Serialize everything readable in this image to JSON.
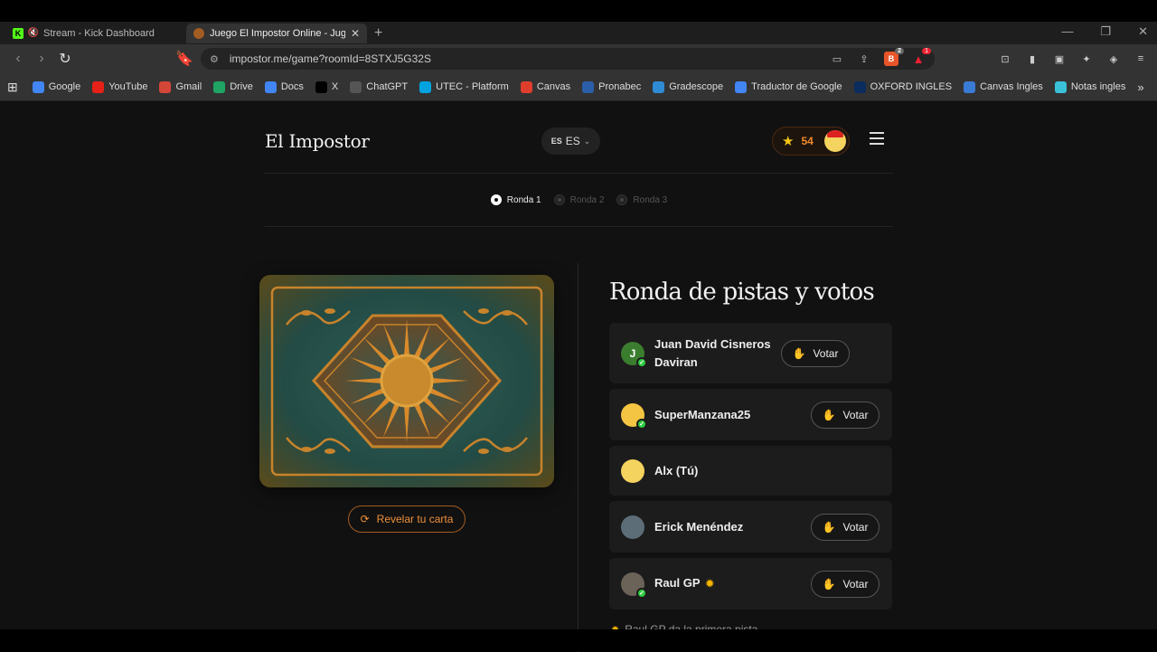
{
  "browser": {
    "tabs": [
      {
        "title": "Stream - Kick Dashboard",
        "active": false
      },
      {
        "title": "Juego El Impostor Online - Jugar",
        "active": true
      }
    ],
    "url": "impostor.me/game?roomId=8STXJ5G32S",
    "extensions": {
      "brave_badge": "2",
      "rewards_badge": "1"
    },
    "bookmarks": [
      {
        "label": "Google",
        "icon": "google-icon",
        "color": "#4285f4"
      },
      {
        "label": "YouTube",
        "icon": "youtube-icon",
        "color": "#e62117"
      },
      {
        "label": "Gmail",
        "icon": "gmail-icon",
        "color": "#d44638"
      },
      {
        "label": "Drive",
        "icon": "drive-icon",
        "color": "#1fa463"
      },
      {
        "label": "Docs",
        "icon": "docs-icon",
        "color": "#4285f4"
      },
      {
        "label": "X",
        "icon": "x-icon",
        "color": "#000000"
      },
      {
        "label": "ChatGPT",
        "icon": "chatgpt-icon",
        "color": "#555555"
      },
      {
        "label": "UTEC - Platform",
        "icon": "utec-icon",
        "color": "#00a3e0"
      },
      {
        "label": "Canvas",
        "icon": "canvas-icon",
        "color": "#e03e2d"
      },
      {
        "label": "Pronabec",
        "icon": "pronabec-icon",
        "color": "#2b5ea8"
      },
      {
        "label": "Gradescope",
        "icon": "gradescope-icon",
        "color": "#2f8bd4"
      },
      {
        "label": "Traductor de Google",
        "icon": "translate-icon",
        "color": "#4285f4"
      },
      {
        "label": "OXFORD INGLES",
        "icon": "oxford-icon",
        "color": "#0a2c5e"
      },
      {
        "label": "Canvas Ingles",
        "icon": "canvas-ingles-icon",
        "color": "#3a7bd5"
      },
      {
        "label": "Notas ingles",
        "icon": "notas-icon",
        "color": "#3ac1d8"
      }
    ]
  },
  "header": {
    "brand": "El Impostor",
    "lang_short": "ES",
    "lang": "ES",
    "points": "54"
  },
  "rounds": [
    {
      "label": "Ronda 1",
      "active": true
    },
    {
      "label": "Ronda 2",
      "active": false
    },
    {
      "label": "Ronda 3",
      "active": false
    }
  ],
  "card": {
    "reveal_label": "Revelar tu carta"
  },
  "main": {
    "title": "Ronda de pistas y votos",
    "vote_label": "Votar",
    "players": [
      {
        "name": "Juan David Cisneros Daviran",
        "initial": "J",
        "avatar_color": "#3b7d2f",
        "ready": true,
        "can_vote": true
      },
      {
        "name": "SuperManzana25",
        "initial": "",
        "avatar_color": "#f4c542",
        "ready": true,
        "can_vote": true
      },
      {
        "name": "Alx (Tú)",
        "initial": "",
        "avatar_color": "#f4d35e",
        "ready": false,
        "can_vote": false
      },
      {
        "name": "Erick Menéndez",
        "initial": "",
        "avatar_color": "#5d6d78",
        "ready": false,
        "can_vote": true
      },
      {
        "name": "Raul GP",
        "initial": "",
        "avatar_color": "#6b6258",
        "ready": true,
        "can_vote": true,
        "first_clue": true
      }
    ],
    "hint": "Raul GP da la primera pista"
  },
  "colors": {
    "accent": "#f08a2a",
    "success": "#2ecc40",
    "background": "#111111"
  }
}
